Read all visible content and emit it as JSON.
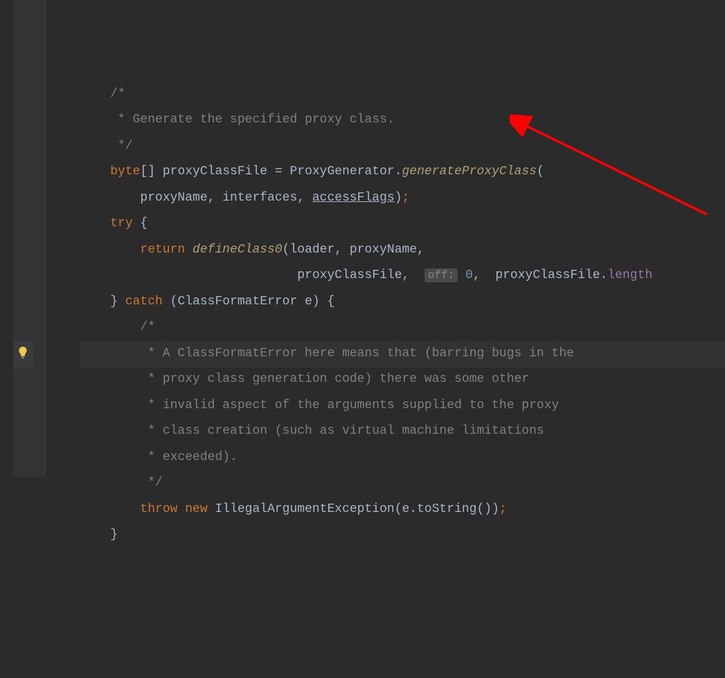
{
  "code": {
    "c1": "/*",
    "c2": " * Generate the specified proxy class.",
    "c3": " */",
    "l4_kw": "byte",
    "l4_rest1": "[] proxyClassFile = ProxyGenerator.",
    "l4_method": "generateProxyClass",
    "l4_paren": "(",
    "l5_args": "proxyName, interfaces, ",
    "l5_underline": "accessFlags",
    "l5_close": ")",
    "l5_semi": ";",
    "l6_try": "try",
    "l6_brace": " {",
    "l7_return": "return ",
    "l7_method": "defineClass0",
    "l7_args": "(loader, proxyName,",
    "l8_a": "proxyClassFile, ",
    "l8_inlay": "off:",
    "l8_num": " 0",
    "l8_b": ",  proxyClassFile.",
    "l8_c": "length",
    "l9_brace": "} ",
    "l9_catch": "catch",
    "l9_rest": " (ClassFormatError e) {",
    "c10": "/*",
    "c11": " * A ClassFormatError here means that (barring bugs in the",
    "c12": " * proxy class generation code) there was some other",
    "c13": " * invalid aspect of the arguments supplied to the proxy",
    "c14": " * class creation (such as virtual machine limitations",
    "c15": " * exceeded).",
    "c16": " */",
    "l17_throw": "throw new ",
    "l17_ex": "IllegalArgumentException(e.toString())",
    "l17_semi": ";",
    "l18": "}"
  },
  "annotation": {
    "color": "#ff0000"
  }
}
